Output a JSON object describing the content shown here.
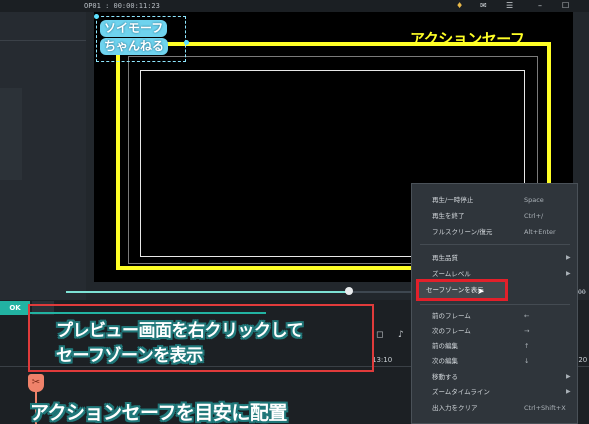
{
  "titlebar": {
    "timecode": "OP01 : 00:00:11:23"
  },
  "preview": {
    "safe_zone_label": "アクションセーフ",
    "logo_line1": "ソイモーフ",
    "logo_line2": "ちゃんねる"
  },
  "player": {
    "zoom_value": "00"
  },
  "timeline": {
    "ok_label": "OK",
    "time_mark_1": "13:10",
    "time_mark_2": ":20"
  },
  "captions": {
    "line1": "プレビュー画面を右クリックして",
    "line2": "セーフゾーンを表示",
    "bottom": "アクションセーフを目安に配置"
  },
  "context_menu": {
    "items": [
      {
        "label": "再生/一時停止",
        "shortcut": "Space",
        "submenu": false
      },
      {
        "label": "再生を終了",
        "shortcut": "Ctrl+/",
        "submenu": false
      },
      {
        "label": "フルスクリーン/復元",
        "shortcut": "Alt+Enter",
        "submenu": false
      },
      {
        "label": "再生品質",
        "shortcut": "",
        "submenu": true
      },
      {
        "label": "ズームレベル",
        "shortcut": "",
        "submenu": true
      },
      {
        "label": "セーフゾーンを表示",
        "shortcut": "",
        "submenu": false,
        "highlighted": true
      },
      {
        "label": "前のフレーム",
        "shortcut": "←",
        "submenu": false
      },
      {
        "label": "次のフレーム",
        "shortcut": "→",
        "submenu": false
      },
      {
        "label": "前の編集",
        "shortcut": "↑",
        "submenu": false
      },
      {
        "label": "次の編集",
        "shortcut": "↓",
        "submenu": false
      },
      {
        "label": "移動する",
        "shortcut": "",
        "submenu": true
      },
      {
        "label": "ズームタイムライン",
        "shortcut": "",
        "submenu": true
      },
      {
        "label": "出入力をクリア",
        "shortcut": "Ctrl+Shift+X",
        "submenu": false
      }
    ]
  },
  "colors": {
    "safe_zone": "#ffff26",
    "accent_teal": "#22b3a2",
    "highlight_red": "#e3202a",
    "playhead": "#f0826a"
  }
}
